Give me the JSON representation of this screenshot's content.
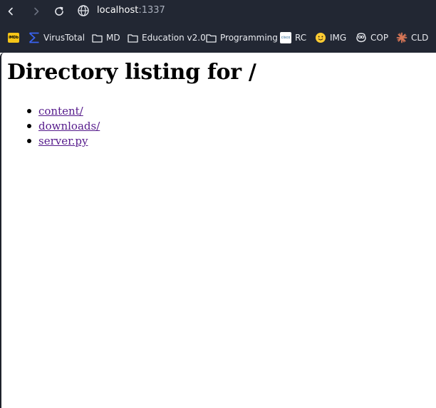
{
  "browser": {
    "url_host": "localhost",
    "url_port": ":1337",
    "bookmarks": [
      {
        "label": "",
        "icon": "imdb-icon",
        "badge": "IMDb"
      },
      {
        "label": "VirusTotal",
        "icon": "virustotal-icon"
      },
      {
        "label": "MD",
        "icon": "folder-icon"
      },
      {
        "label": "Education v2.0",
        "icon": "folder-icon"
      },
      {
        "label": "Programming",
        "icon": "folder-icon"
      },
      {
        "label": "RC",
        "icon": "cisco-icon",
        "badge": "cisco"
      },
      {
        "label": "IMG",
        "icon": "huggingface-icon"
      },
      {
        "label": "COP",
        "icon": "copilot-icon"
      },
      {
        "label": "CLD",
        "icon": "claude-icon"
      }
    ]
  },
  "page": {
    "heading": "Directory listing for /",
    "entries": [
      {
        "name": "content/"
      },
      {
        "name": "downloads/"
      },
      {
        "name": "server.py"
      }
    ]
  },
  "colors": {
    "chrome_bg": "#222733",
    "link_visited": "#551a8b",
    "imdb_yellow": "#f5c518",
    "virustotal_blue": "#3a63f2",
    "claude_orange": "#d97757"
  }
}
